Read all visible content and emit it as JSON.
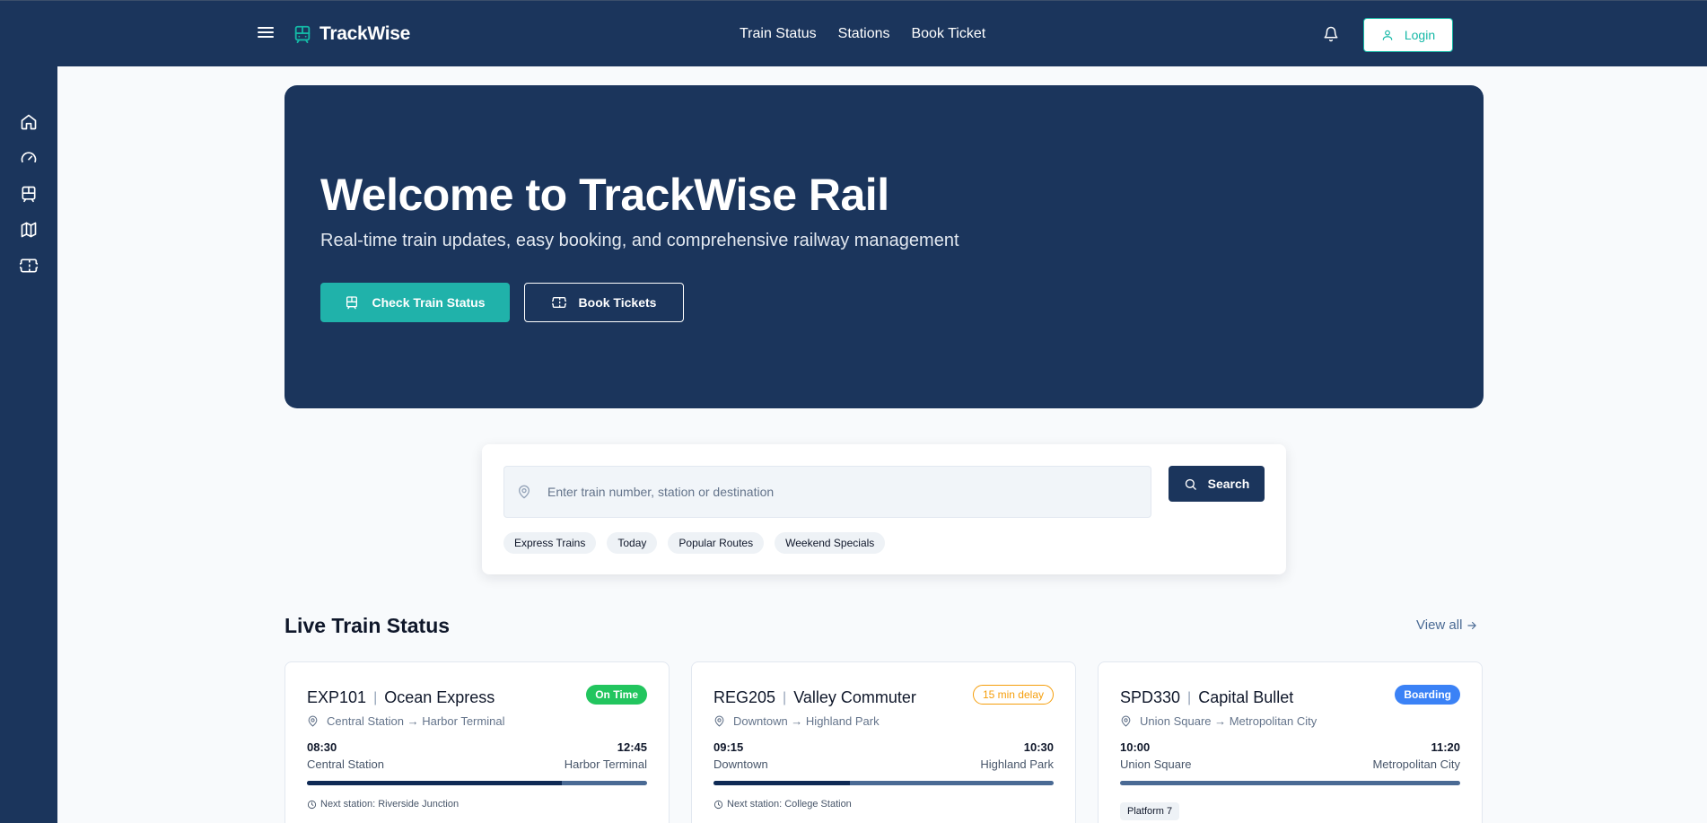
{
  "app": {
    "brand": "TrackWise",
    "accent_color": "#14b8a6",
    "primary_color": "#1b355c"
  },
  "header": {
    "menu_icon": "hamburger-icon",
    "brand_icon": "train-icon",
    "nav": [
      {
        "label": "Train Status"
      },
      {
        "label": "Stations"
      },
      {
        "label": "Book Ticket"
      }
    ],
    "notification_icon": "bell-icon",
    "login_label": "Login"
  },
  "sidebar": {
    "items": [
      {
        "icon": "home-icon"
      },
      {
        "icon": "gauge-icon"
      },
      {
        "icon": "train-icon"
      },
      {
        "icon": "map-icon"
      },
      {
        "icon": "ticket-icon"
      }
    ]
  },
  "hero": {
    "title": "Welcome to TrackWise Rail",
    "subtitle": "Real-time train updates, easy booking, and comprehensive railway management",
    "primary_button": "Check Train Status",
    "secondary_button": "Book Tickets"
  },
  "search": {
    "placeholder": "Enter train number, station or destination",
    "button_label": "Search",
    "chips": [
      "Express Trains",
      "Today",
      "Popular Routes",
      "Weekend Specials"
    ]
  },
  "live_status": {
    "title": "Live Train Status",
    "view_all": "View all",
    "trains": [
      {
        "number": "EXP101",
        "name": "Ocean Express",
        "status": "On Time",
        "status_color": "#22c55e",
        "route": "Central Station → Harbor Terminal",
        "depart_time": "08:30",
        "arrive_time": "12:45",
        "from": "Central Station",
        "to": "Harbor Terminal",
        "progress_pct": 75,
        "next_station": "Next station: Riverside Junction"
      },
      {
        "number": "REG205",
        "name": "Valley Commuter",
        "status": "15 min delay",
        "status_color": "#f59e0b",
        "route": "Downtown → Highland Park",
        "depart_time": "09:15",
        "arrive_time": "10:30",
        "from": "Downtown",
        "to": "Highland Park",
        "progress_pct": 40,
        "next_station": "Next station: College Station"
      },
      {
        "number": "SPD330",
        "name": "Capital Bullet",
        "status": "Boarding",
        "status_color": "#3b82f6",
        "route": "Union Square → Metropolitan City",
        "depart_time": "10:00",
        "arrive_time": "11:20",
        "from": "Union Square",
        "to": "Metropolitan City",
        "progress_pct": 0,
        "platform": "Platform 7"
      }
    ]
  }
}
